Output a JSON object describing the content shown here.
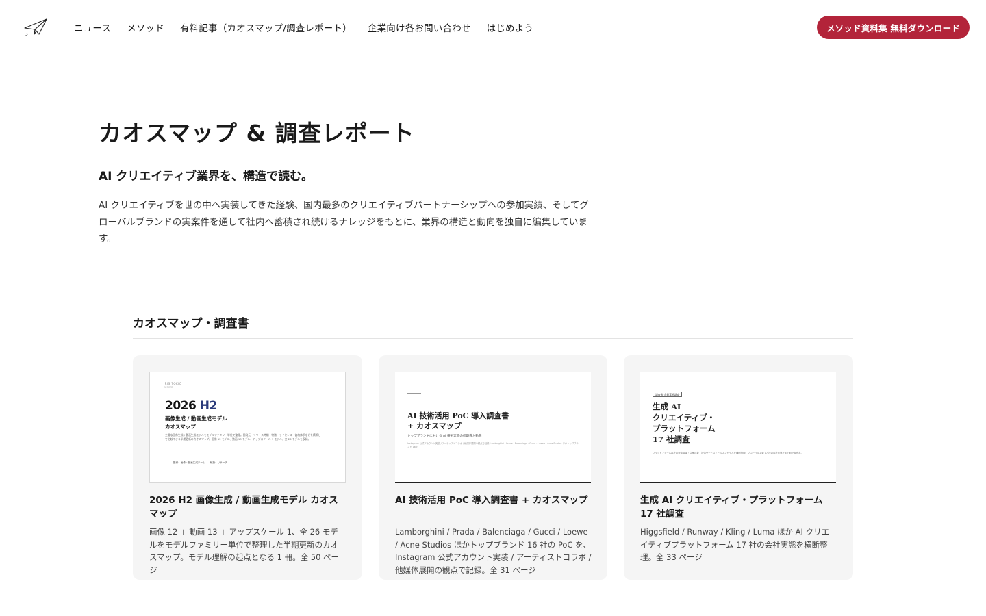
{
  "header": {
    "logo_icon": "paper-plane-icon",
    "nav": [
      {
        "label": "ニュース"
      },
      {
        "label": "メソッド"
      },
      {
        "label": "有料記事（カオスマップ/調査レポート）"
      },
      {
        "label": "企業向け各お問い合わせ"
      },
      {
        "label": "はじめよう"
      }
    ],
    "cta_label": "メソッド資料集 無料ダウンロード",
    "cta_color": "#b3243a"
  },
  "hero": {
    "title": "カオスマップ & 調査レポート",
    "subtitle": "AI クリエイティブ業界を、構造で読む。",
    "description": "AI クリエイティブを世の中へ実装してきた経験、国内最多のクリエイティブパートナーシップへの参加実績、そしてグローバルブランドの実案件を通して社内へ蓄積され続けるナレッジをもとに、業界の構造と動向を独自に編集しています。"
  },
  "section": {
    "title": "カオスマップ・調査書",
    "cards": [
      {
        "title": "2026 H2 画像生成 / 動画生成モデル カオスマップ",
        "description": "画像 12 + 動画 13 + アップスケール 1、全 26 モデルをモデルファミリー単位で整理した半期更新のカオスマップ。モデル理解の起点となる 1 冊。全 50 ページ",
        "thumb": {
          "tiny_top": "IRIS TOKIO",
          "tiny_sub": "REPORT",
          "year": "2026",
          "year_accent": "H2",
          "line1": "画像生成 / 動画生成モデル",
          "line2": "カオスマップ",
          "body": "主要な画像生成 / 動画生成モデルをモデルファミリー単位で整理。開発元・リリース時期・特徴・ライセンス・価格体系などを横断して比較できる半期更新のカオスマップ。画像 12 モデル、動画 13 モデル、アップスケール 1 モデル、全 26 モデルを収録。",
          "foot": "監修：画像・動画生成チーム　　執筆：リサーチ"
        }
      },
      {
        "title": "AI 技術活用 PoC 導入調査書 + カオスマップ",
        "description": "Lamborghini / Prada / Balenciaga / Gucci / Loewe / Acne Studios ほかトップブランド 16 社の PoC を、Instagram 公式アカウント実装 / アーティストコラボ / 他媒体展開の観点で記録。全 31 ページ",
        "thumb": {
          "line1": "AI 技術活用 PoC 導入調査書",
          "line2": "+ カオスマップ",
          "sub": "トップブランドにおける AI 技術実装の初期導入動向",
          "small": "Instagram 公式アカウント実装 / アーティストコラボ / 他媒体展開の観点で記録 Lamborghini · Prada · Balenciaga · Gucci · Loewe · Acne Studios ほかトップブランド 16 社"
        }
      },
      {
        "title": "生成 AI クリエイティブ・プラットフォーム 17 社調査",
        "description": "Higgsfield / Runway / Kling / Luma ほか AI クリエイティブプラットフォーム 17 社の会社実態を横断整理。全 33 ページ",
        "thumb": {
          "tag": "調査書 企業実態調査",
          "line1": "生成 AI",
          "line2": "クリエイティブ・",
          "line3": "プラットフォーム",
          "line4": "17 社調査",
          "small": "プラットフォーム各社の資金調達・従業員数・提供サービス・ビジネスモデルを横断整理。グローバル主要 17 社の会社実態をまとめた調査書。"
        }
      }
    ]
  }
}
